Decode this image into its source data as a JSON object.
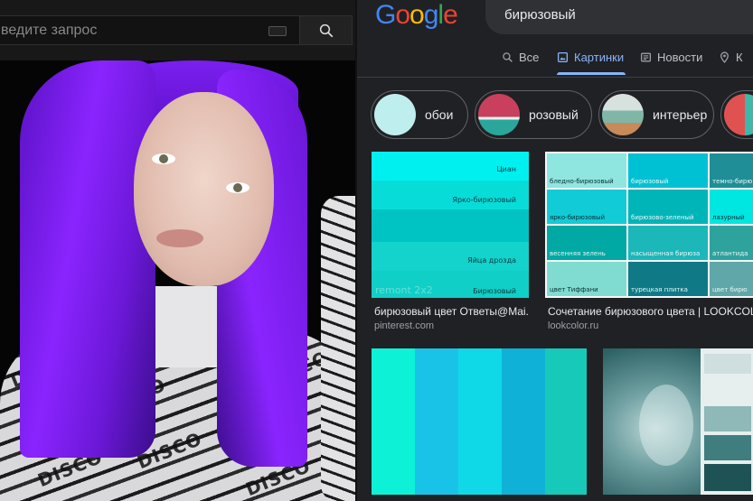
{
  "left_panel": {
    "search": {
      "placeholder": "ведите запрос"
    },
    "video": {
      "shirt_text": "DISCO"
    }
  },
  "right_panel": {
    "logo": "Google",
    "search_query": "бирюзовый",
    "tabs": [
      {
        "label": "Все",
        "icon": "search-icon",
        "active": false
      },
      {
        "label": "Картинки",
        "icon": "image-icon",
        "active": true
      },
      {
        "label": "Новости",
        "icon": "news-icon",
        "active": false
      },
      {
        "label": "К",
        "icon": "map-pin-icon",
        "active": false
      }
    ],
    "chips": [
      {
        "label": "обои",
        "color": "#bfeeee"
      },
      {
        "label": "розовый",
        "color": "#d9536c"
      },
      {
        "label": "интерьер",
        "color": "#7fb6a8"
      },
      {
        "label": "",
        "color": "#e05252"
      }
    ],
    "results": [
      {
        "title": "бирюзовый цвет Ответы@Mai...",
        "source": "pinterest.com",
        "swatch_labels": [
          "Циан",
          "Ярко-бирюзовый",
          "",
          "Яйца дрозда",
          "Бирюзовый"
        ],
        "watermark": "remont 2x2"
      },
      {
        "title": "Сочетание бирюзового цвета | LOOKCOLOR",
        "source": "lookcolor.ru",
        "grid_labels": [
          "бледно-бирюзовый",
          "бирюзовый",
          "темно-бирю",
          "ярко-бирюзовый",
          "бирюзово-зеленый",
          "лазурный",
          "весенняя зелень",
          "насыщенная бирюза",
          "атлантида",
          "цвет Тиффани",
          "турецкая плитка",
          "цвет бирю"
        ]
      },
      {
        "title": "",
        "source": ""
      },
      {
        "title": "",
        "source": ""
      }
    ]
  },
  "colors": {
    "google_blue": "#4285f4",
    "google_red": "#ea4335",
    "google_yellow": "#fbbc05",
    "google_green": "#34a853",
    "active_tab": "#8ab4f8"
  }
}
